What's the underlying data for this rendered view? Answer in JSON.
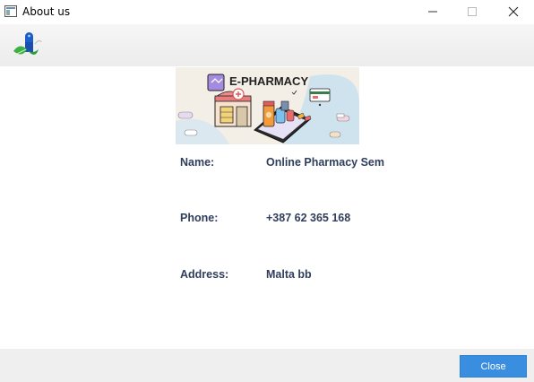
{
  "window": {
    "title": "About us",
    "icon": "window-app-icon",
    "controls": [
      "minimize-icon",
      "maximize-icon",
      "close-icon"
    ]
  },
  "header": {
    "logo": "pharmacy-logo-icon"
  },
  "banner": {
    "text": "E-PHARMACY"
  },
  "info": [
    {
      "label": "Name:",
      "value": "Online Pharmacy Sem"
    },
    {
      "label": "Phone:",
      "value": "+387 62 365 168"
    },
    {
      "label": "Address:",
      "value": "Malta bb"
    }
  ],
  "footer": {
    "close_label": "Close"
  },
  "colors": {
    "accent": "#3a8ee0",
    "label_text": "#2f3e5c",
    "footer_bg": "#efefef"
  }
}
